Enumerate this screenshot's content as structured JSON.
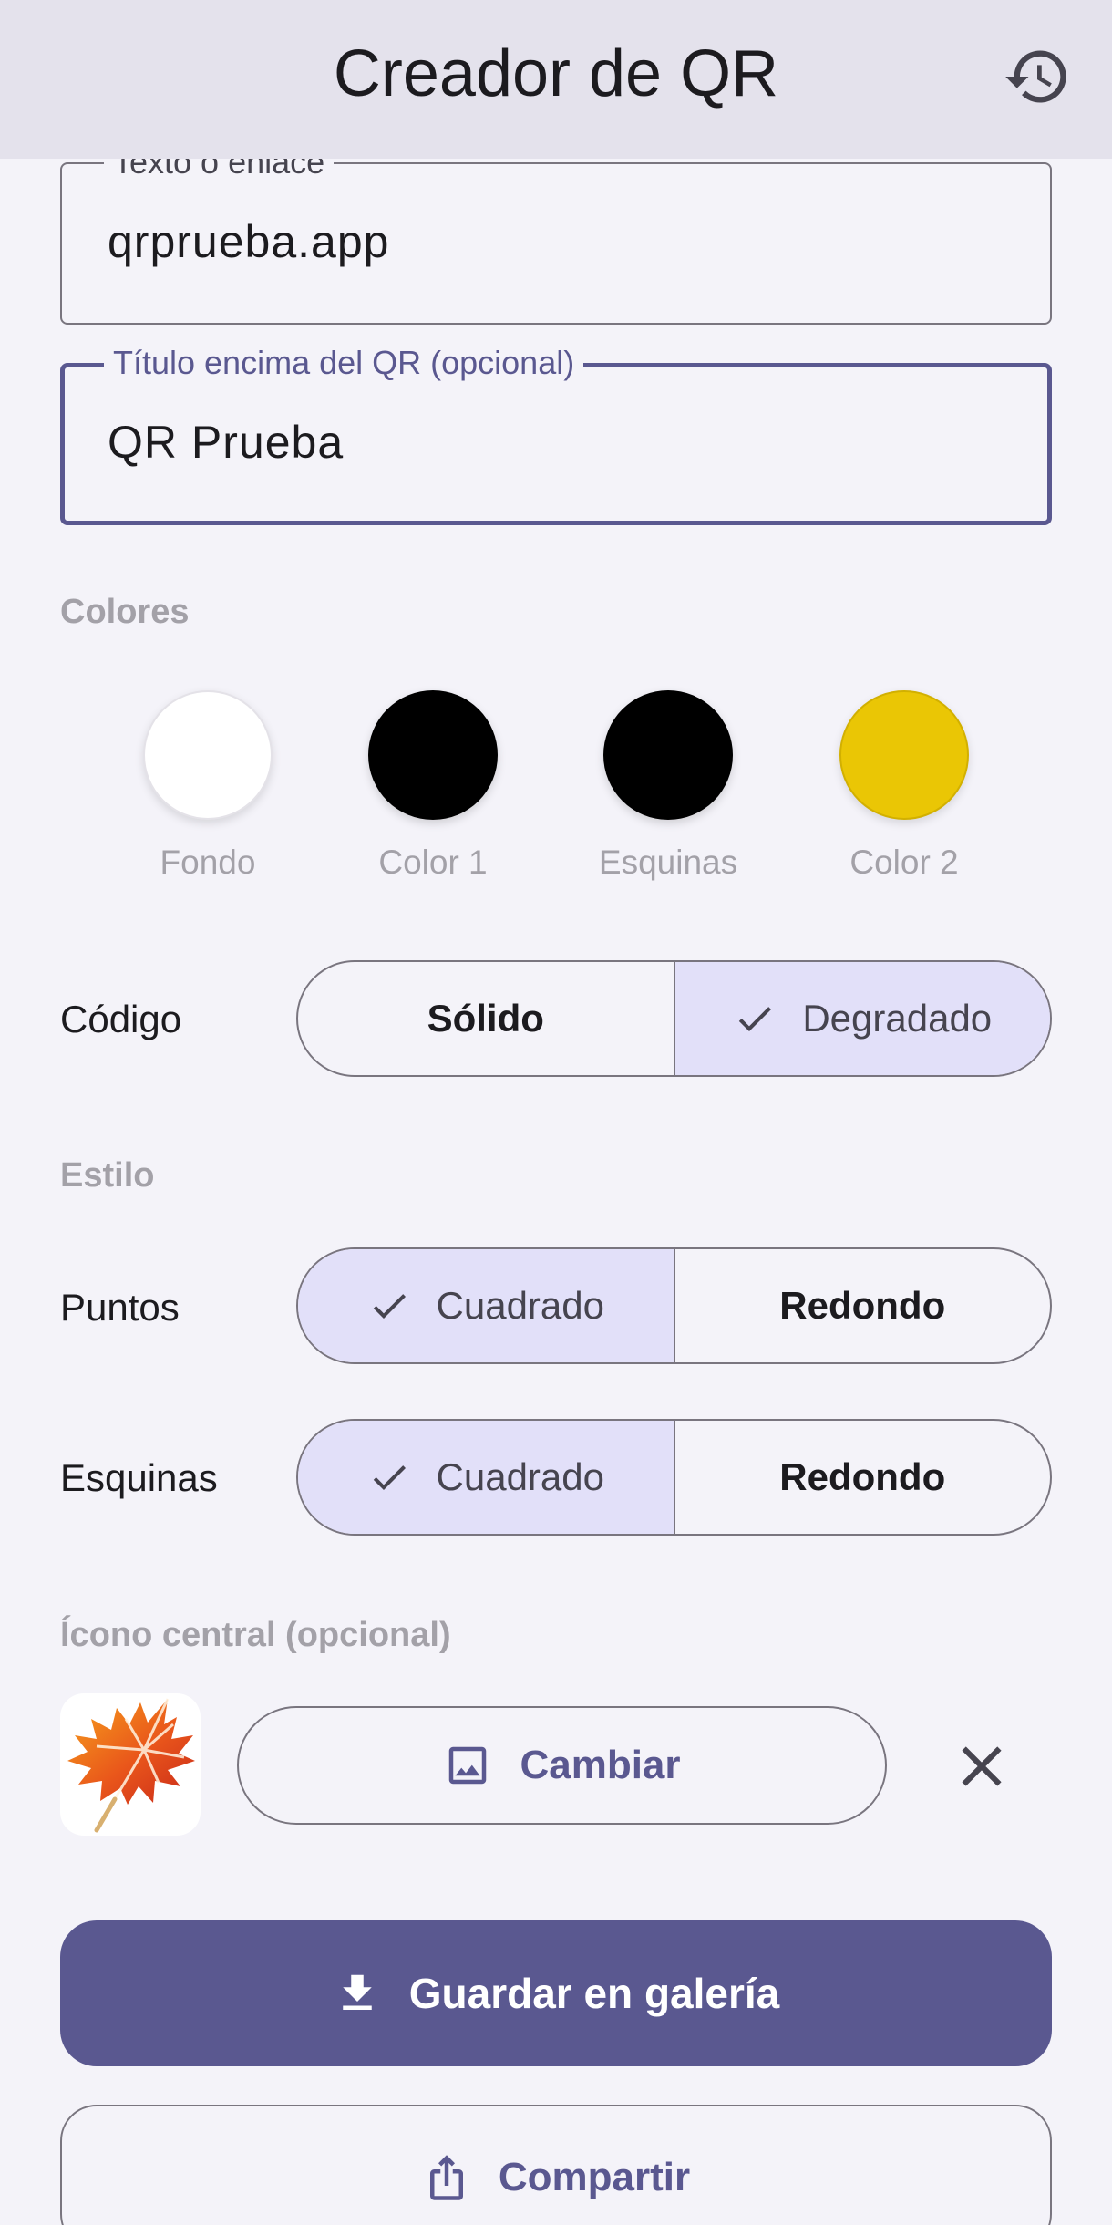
{
  "app_bar": {
    "title": "Creador de QR",
    "history_icon": "history-icon"
  },
  "fields": {
    "text_link": {
      "label": "Texto o enlace",
      "value": "qrprueba.app"
    },
    "title_above": {
      "label": "Título encima del QR (opcional)",
      "value": "QR Prueba"
    }
  },
  "colors": {
    "heading": "Colores",
    "swatches": [
      {
        "label": "Fondo",
        "color": "#ffffff"
      },
      {
        "label": "Color 1",
        "color": "#000000"
      },
      {
        "label": "Esquinas",
        "color": "#000000"
      },
      {
        "label": "Color 2",
        "color": "#eac605"
      }
    ]
  },
  "code": {
    "label": "Código",
    "options": [
      "Sólido",
      "Degradado"
    ],
    "selected": "Degradado"
  },
  "style": {
    "heading": "Estilo",
    "dots": {
      "label": "Puntos",
      "options": [
        "Cuadrado",
        "Redondo"
      ],
      "selected": "Cuadrado"
    },
    "corners": {
      "label": "Esquinas",
      "options": [
        "Cuadrado",
        "Redondo"
      ],
      "selected": "Cuadrado"
    }
  },
  "center_icon": {
    "heading": "Ícono central (opcional)",
    "thumbnail": "maple-leaf-icon",
    "change_label": "Cambiar",
    "remove_icon": "close-icon"
  },
  "actions": {
    "save_label": "Guardar en galería",
    "share_label": "Compartir"
  },
  "theme": {
    "primary": "#5a5890",
    "selected_segment": "#e2e0f9",
    "app_bar_bg": "#e4e2ec",
    "page_bg": "#f4f3f9"
  }
}
